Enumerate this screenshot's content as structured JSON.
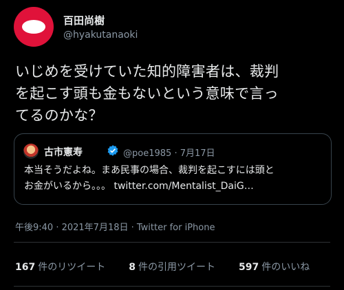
{
  "author": {
    "display_name": "百田尚樹",
    "handle": "@hyakutanaoki"
  },
  "tweet": {
    "text": "いじめを受けていた知的障害者は、裁判\nを起こす頭も金もないという意味で言っ\nてるのかな？"
  },
  "quote": {
    "display_name": "古市憲寿",
    "handle": "@poe1985",
    "separator": "·",
    "date": "7月17日",
    "text": "本当そうだよね。まあ民事の場合、裁判を起こすには頭と\nお金がいるから。。。",
    "link": "twitter.com/Mentalist_DaiG…"
  },
  "meta": {
    "timestamp": "午後9:40 · 2021年7月18日 · Twitter for iPhone"
  },
  "stats": {
    "retweets_count": "167",
    "retweets_label": "件のリツイート",
    "quotes_count": "8",
    "quotes_label": "件の引用ツイート",
    "likes_count": "597",
    "likes_label": "件のいいね"
  },
  "colors": {
    "background": "#000000",
    "avatar_red": "#e0123a",
    "secondary_text": "#8b98a5",
    "verified_blue": "#1d9bf0"
  }
}
